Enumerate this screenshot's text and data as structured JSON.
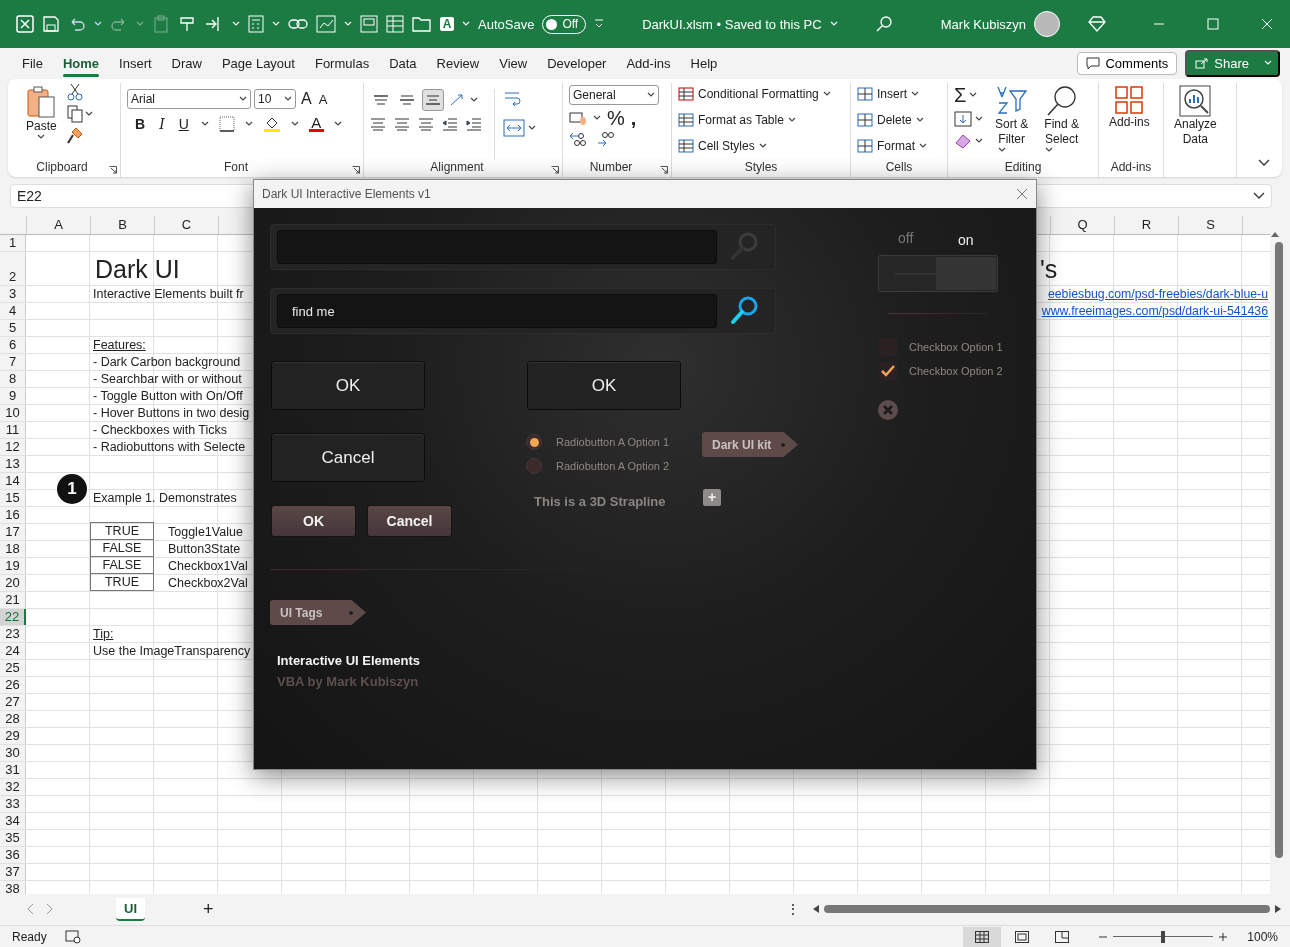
{
  "title_bar": {
    "autosave": {
      "label": "AutoSave",
      "state_label": "Off",
      "on": false
    },
    "file_title": "DarkUI.xlsm • Saved to this PC",
    "user": "Mark Kubiszyn",
    "font_glyph": "A"
  },
  "tabs": [
    {
      "label": "File",
      "selected": false
    },
    {
      "label": "Home",
      "selected": true
    },
    {
      "label": "Insert",
      "selected": false
    },
    {
      "label": "Draw",
      "selected": false
    },
    {
      "label": "Page Layout",
      "selected": false
    },
    {
      "label": "Formulas",
      "selected": false
    },
    {
      "label": "Data",
      "selected": false
    },
    {
      "label": "Review",
      "selected": false
    },
    {
      "label": "View",
      "selected": false
    },
    {
      "label": "Developer",
      "selected": false
    },
    {
      "label": "Add-ins",
      "selected": false
    },
    {
      "label": "Help",
      "selected": false
    }
  ],
  "comments_button": "Comments",
  "share_button": "Share",
  "ribbon": {
    "clipboard": {
      "paste": "Paste",
      "label": "Clipboard"
    },
    "font": {
      "name": "Arial",
      "size": "10",
      "grow": "A",
      "shrink": "A",
      "bold": "B",
      "italic": "I",
      "underline": "U",
      "color_glyph": "A",
      "label": "Font"
    },
    "alignment": {
      "buttons": [
        {
          "kind": "top",
          "selected": false
        },
        {
          "kind": "middle",
          "selected": false
        },
        {
          "kind": "bottom",
          "selected": true
        }
      ],
      "label": "Alignment"
    },
    "number": {
      "format": "General",
      "percent": "%",
      "comma": ",",
      "label": "Number"
    },
    "styles": {
      "items": [
        "Conditional Formatting",
        "Format as Table",
        "Cell Styles"
      ],
      "label": "Styles"
    },
    "cells": {
      "items": [
        "Insert",
        "Delete",
        "Format"
      ],
      "label": "Cells"
    },
    "editing": {
      "sum": "Σ",
      "sort": [
        "Sort &",
        "Filter"
      ],
      "find": [
        "Find &",
        "Select"
      ],
      "label": "Editing"
    },
    "addins": {
      "button": "Add-ins",
      "label": "Add-ins"
    },
    "analyze": [
      "Analyze",
      "Data"
    ]
  },
  "name_box": "E22",
  "sheet": {
    "columns_left": [
      "A",
      "B",
      "C"
    ],
    "columns_right": [
      "Q",
      "R",
      "S"
    ],
    "rows": [
      {
        "number": "1",
        "selected": false
      },
      {
        "number": "2",
        "selected": false,
        "b": {
          "text": "Dark UI",
          "kind": "title"
        },
        "right": {
          "text": "'s",
          "kind": "title"
        }
      },
      {
        "number": "3",
        "selected": false,
        "b": {
          "text": "Interactive Elements built fr",
          "kind": "text"
        },
        "right": {
          "text": "eebiesbug.com/psd-freebies/dark-blue-u",
          "kind": "link"
        }
      },
      {
        "number": "4",
        "selected": false,
        "right": {
          "text": "www.freeimages.com/psd/dark-ui-541436",
          "kind": "link"
        }
      },
      {
        "number": "5",
        "selected": false
      },
      {
        "number": "6",
        "selected": false,
        "b": {
          "text": "Features:",
          "kind": "heading"
        }
      },
      {
        "number": "7",
        "selected": false,
        "b": {
          "text": "- Dark Carbon background",
          "kind": "text"
        }
      },
      {
        "number": "8",
        "selected": false,
        "b": {
          "text": "- Searchbar with or without",
          "kind": "text"
        }
      },
      {
        "number": "9",
        "selected": false,
        "b": {
          "text": "- Toggle Button with On/Off",
          "kind": "text"
        }
      },
      {
        "number": "10",
        "selected": false,
        "b": {
          "text": "- Hover Buttons in two desig",
          "kind": "text"
        }
      },
      {
        "number": "11",
        "selected": false,
        "b": {
          "text": "- Checkboxes with Ticks",
          "kind": "text"
        }
      },
      {
        "number": "12",
        "selected": false,
        "b": {
          "text": "- Radiobuttons with Selecte",
          "kind": "text"
        }
      },
      {
        "number": "13",
        "selected": false
      },
      {
        "number": "14",
        "selected": false
      },
      {
        "number": "15",
        "selected": false,
        "b": {
          "text": "Example 1.  Demonstrates",
          "kind": "text"
        },
        "badge": "1"
      },
      {
        "number": "16",
        "selected": false
      },
      {
        "number": "17",
        "selected": false,
        "b": {
          "text": "TRUE",
          "kind": "boxed"
        },
        "c": "Toggle1Value"
      },
      {
        "number": "18",
        "selected": false,
        "b": {
          "text": "FALSE",
          "kind": "boxed"
        },
        "c": "Button3State"
      },
      {
        "number": "19",
        "selected": false,
        "b": {
          "text": "FALSE",
          "kind": "boxed"
        },
        "c": "Checkbox1Val"
      },
      {
        "number": "20",
        "selected": false,
        "b": {
          "text": "TRUE",
          "kind": "boxed"
        },
        "c": "Checkbox2Val"
      },
      {
        "number": "21",
        "selected": false
      },
      {
        "number": "22",
        "selected": true
      },
      {
        "number": "23",
        "selected": false,
        "b": {
          "text": "Tip:",
          "kind": "heading"
        }
      },
      {
        "number": "24",
        "selected": false,
        "b": {
          "text": "Use the ImageTransparency",
          "kind": "text"
        }
      },
      {
        "number": "25",
        "selected": false
      },
      {
        "number": "26",
        "selected": false
      },
      {
        "number": "27",
        "selected": false
      },
      {
        "number": "28",
        "selected": false
      },
      {
        "number": "29",
        "selected": false
      },
      {
        "number": "30",
        "selected": false
      },
      {
        "number": "31",
        "selected": false
      },
      {
        "number": "32",
        "selected": false
      },
      {
        "number": "33",
        "selected": false
      },
      {
        "number": "34",
        "selected": false
      },
      {
        "number": "35",
        "selected": false
      },
      {
        "number": "36",
        "selected": false
      },
      {
        "number": "37",
        "selected": false
      },
      {
        "number": "38",
        "selected": false
      }
    ]
  },
  "dialog": {
    "title": "Dark UI Interactive Elements v1",
    "search_bars": [
      {
        "active": false
      },
      {
        "value": "find me",
        "active": true
      }
    ],
    "toggle": {
      "off_label": "off",
      "on_label": "on",
      "on": true
    },
    "checkboxes": [
      {
        "label": "Checkbox Option 1",
        "checked": false
      },
      {
        "label": "Checkbox Option 2",
        "checked": true
      }
    ],
    "large_buttons": [
      "OK",
      "OK",
      "Cancel"
    ],
    "radios": [
      {
        "label": "Radiobutton A Option 1",
        "selected": true
      },
      {
        "label": "Radiobutton A Option 2",
        "selected": false
      }
    ],
    "tags": [
      "Dark UI kit",
      "UI Tags"
    ],
    "strapline": "This is a 3D Strapline",
    "plus": "+",
    "small_buttons": [
      "OK",
      "Cancel"
    ],
    "footer_title": "Interactive UI Elements",
    "footer_subtitle": "VBA by Mark Kubiszyn"
  },
  "sheet_tabs": [
    {
      "label": "UI",
      "selected": true
    }
  ],
  "add_sheet": "+",
  "more": "⋮",
  "status_bar": {
    "text": "Ready",
    "views": [
      {
        "kind": "normal",
        "selected": true
      },
      {
        "kind": "page-layout",
        "selected": false
      },
      {
        "kind": "page-break",
        "selected": false
      }
    ],
    "zoom": {
      "level": 0.5,
      "reading": "100%"
    }
  }
}
